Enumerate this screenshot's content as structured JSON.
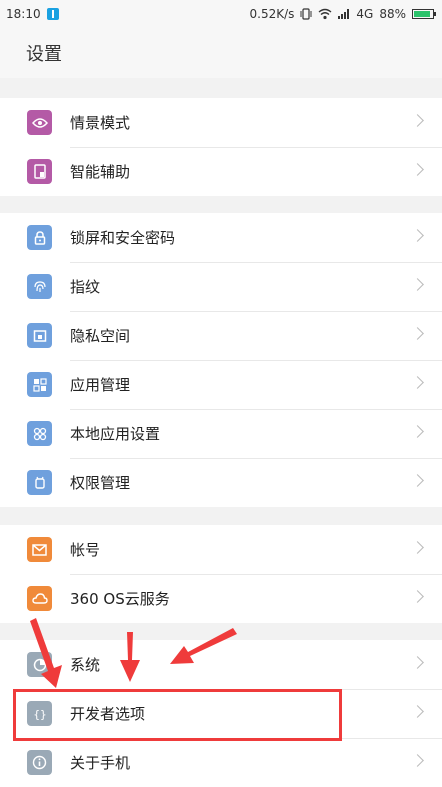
{
  "status_bar": {
    "time": "18:10",
    "speed": "0.52K/s",
    "network": "4G",
    "battery": "88%",
    "battery_level": 0.88,
    "icons": [
      "usb-icon",
      "vibrate-icon",
      "wifi-icon",
      "signal-icon",
      "battery-icon"
    ]
  },
  "header": {
    "title": "设置"
  },
  "groups": [
    {
      "items": [
        {
          "label": "情景模式",
          "icon": "eye-icon",
          "color": "#b45aa6"
        },
        {
          "label": "智能辅助",
          "icon": "phone-icon",
          "color": "#b45aa6"
        }
      ]
    },
    {
      "items": [
        {
          "label": "锁屏和安全密码",
          "icon": "lock-icon",
          "color": "#6fa0dd"
        },
        {
          "label": "指纹",
          "icon": "fingerprint-icon",
          "color": "#6fa0dd"
        },
        {
          "label": "隐私空间",
          "icon": "privacy-icon",
          "color": "#6fa0dd"
        },
        {
          "label": "应用管理",
          "icon": "apps-grid-icon",
          "color": "#6fa0dd"
        },
        {
          "label": "本地应用设置",
          "icon": "clover-icon",
          "color": "#6fa0dd"
        },
        {
          "label": "权限管理",
          "icon": "android-icon",
          "color": "#6fa0dd"
        }
      ]
    },
    {
      "items": [
        {
          "label": "帐号",
          "icon": "mail-icon",
          "color": "#f08a3a"
        },
        {
          "label": "360 OS云服务",
          "icon": "cloud-icon",
          "color": "#f08a3a"
        }
      ]
    },
    {
      "items": [
        {
          "label": "系统",
          "icon": "pie-icon",
          "color": "#9aa9b6"
        },
        {
          "label": "开发者选项",
          "icon": "braces-icon",
          "color": "#9aa9b6"
        },
        {
          "label": "关于手机",
          "icon": "info-icon",
          "color": "#9aa9b6"
        }
      ]
    }
  ],
  "annotation_color": "#ef3b3b"
}
